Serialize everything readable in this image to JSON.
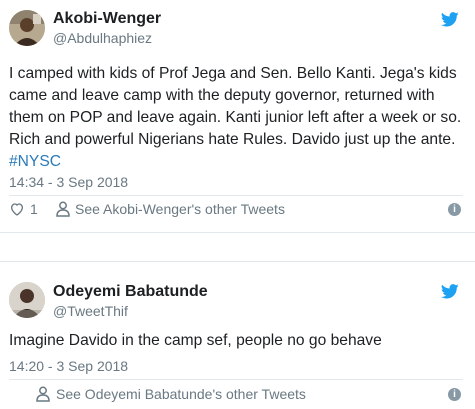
{
  "tweets": [
    {
      "display_name": "Akobi-Wenger",
      "handle": "@Abdulhaphiez",
      "text": "I camped with kids of Prof Jega and Sen. Bello Kanti. Jega's kids came and leave camp with the deputy governor, returned with them on POP and leave again. Kanti junior left after a week or so. Rich and powerful Nigerians hate Rules. Davido just up the ante. ",
      "hashtag": "#NYSC",
      "timestamp": "14:34 - 3 Sep 2018",
      "like_count": "1",
      "other_tweets_link": "See Akobi-Wenger's other Tweets",
      "avatar_icon": "profile-photo",
      "platform_icon": "twitter-bird-icon"
    },
    {
      "display_name": "Odeyemi Babatunde",
      "handle": "@TweetThif",
      "text": "Imagine Davido in the camp sef, people no go behave",
      "timestamp": "14:20 - 3 Sep 2018",
      "other_tweets_link": "See Odeyemi Babatunde's other Tweets",
      "avatar_icon": "profile-photo",
      "platform_icon": "twitter-bird-icon"
    }
  ],
  "info_glyph": "i",
  "colors": {
    "link": "#2b7bb9",
    "twitter_blue": "#1da1f2",
    "muted": "#697882",
    "text": "#1c2022",
    "border": "#e1e8ed"
  }
}
